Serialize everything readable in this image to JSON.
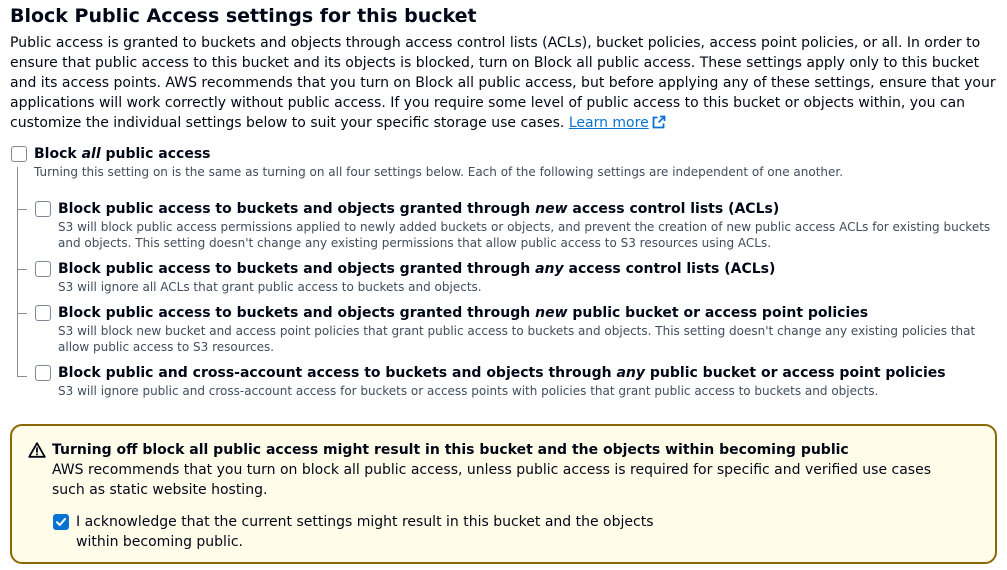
{
  "heading": "Block Public Access settings for this bucket",
  "description": "Public access is granted to buckets and objects through access control lists (ACLs), bucket policies, access point policies, or all. In order to ensure that public access to this bucket and its objects is blocked, turn on Block all public access. These settings apply only to this bucket and its access points. AWS recommends that you turn on Block all public access, but before applying any of these settings, ensure that your applications will work correctly without public access. If you require some level of public access to this bucket or objects within, you can customize the individual settings below to suit your specific storage use cases.",
  "learn_more": "Learn more",
  "block_all": {
    "label_pre": "Block ",
    "label_em": "all",
    "label_post": " public access",
    "desc": "Turning this setting on is the same as turning on all four settings below. Each of the following settings are independent of one another.",
    "checked": false
  },
  "options": [
    {
      "label_pre": "Block public access to buckets and objects granted through ",
      "label_em": "new",
      "label_post": " access control lists (ACLs)",
      "desc": "S3 will block public access permissions applied to newly added buckets or objects, and prevent the creation of new public access ACLs for existing buckets and objects. This setting doesn't change any existing permissions that allow public access to S3 resources using ACLs.",
      "checked": false
    },
    {
      "label_pre": "Block public access to buckets and objects granted through ",
      "label_em": "any",
      "label_post": " access control lists (ACLs)",
      "desc": "S3 will ignore all ACLs that grant public access to buckets and objects.",
      "checked": false
    },
    {
      "label_pre": "Block public access to buckets and objects granted through ",
      "label_em": "new",
      "label_post": " public bucket or access point policies",
      "desc": "S3 will block new bucket and access point policies that grant public access to buckets and objects. This setting doesn't change any existing policies that allow public access to S3 resources.",
      "checked": false
    },
    {
      "label_pre": "Block public and cross-account access to buckets and objects through ",
      "label_em": "any",
      "label_post": " public bucket or access point policies",
      "desc": "S3 will ignore public and cross-account access for buckets or access points with policies that grant public access to buckets and objects.",
      "checked": false
    }
  ],
  "alert": {
    "icon": "warning-icon",
    "title": "Turning off block all public access might result in this bucket and the objects within becoming public",
    "body": "AWS recommends that you turn on block all public access, unless public access is required for specific and verified use cases such as static website hosting.",
    "ack_label": "I acknowledge that the current settings might result in this bucket and the objects within becoming public.",
    "ack_checked": true
  },
  "colors": {
    "link": "#0972d3",
    "checkbox_checked": "#0972d3",
    "alert_border": "#8d6605",
    "alert_bg": "#fffce9"
  }
}
